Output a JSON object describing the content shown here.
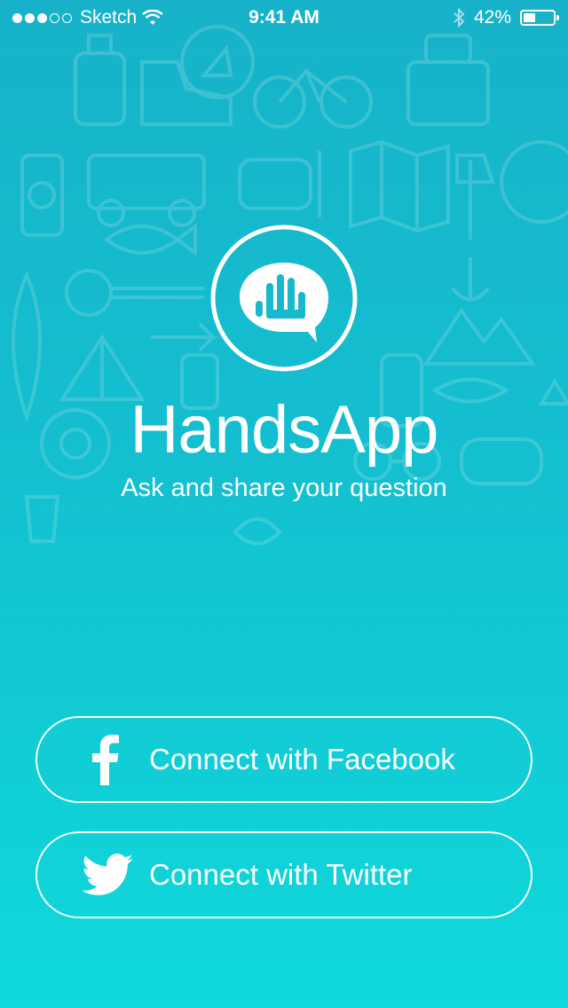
{
  "status_bar": {
    "signal": "●●●○○",
    "carrier": "Sketch",
    "time": "9:41 AM",
    "battery": "42%",
    "battery_level": 0.42
  },
  "app": {
    "title": "HandsApp",
    "tagline": "Ask and share your question"
  },
  "buttons": {
    "facebook_label": "Connect with Facebook",
    "twitter_label": "Connect with Twitter"
  },
  "colors": {
    "gradient_top": "#17b2c9",
    "gradient_bottom": "#0fd9db",
    "foreground": "#ffffff"
  },
  "icons": [
    "signal-dots-icon",
    "wifi-icon",
    "bluetooth-icon",
    "battery-icon",
    "chat-hand-logo-icon",
    "facebook-icon",
    "twitter-bird-icon"
  ]
}
